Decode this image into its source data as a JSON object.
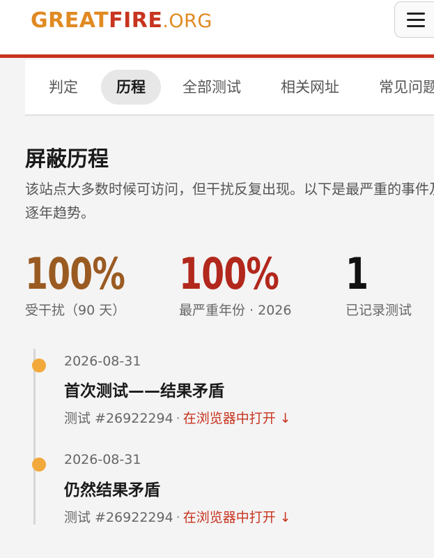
{
  "header": {
    "logo_great": "GREAT",
    "logo_fire": "FIRE",
    "logo_org": ".ORG"
  },
  "tabs": [
    {
      "label": "判定",
      "active": false
    },
    {
      "label": "历程",
      "active": true
    },
    {
      "label": "全部测试",
      "active": false
    },
    {
      "label": "相关网址",
      "active": false
    },
    {
      "label": "常见问题",
      "active": false
    }
  ],
  "section": {
    "title": "屏蔽历程",
    "description": "该站点大多数时候可访问，但干扰反复出现。以下是最严重的事件及逐年趋势。"
  },
  "stats": [
    {
      "value": "100%",
      "label": "受干扰（90 天）",
      "color": "#9a5b22"
    },
    {
      "value": "100%",
      "label": "最严重年份 · 2026",
      "color": "#b2281c"
    },
    {
      "value": "1",
      "label": "已记录测试",
      "color": "#111111"
    }
  ],
  "timeline": [
    {
      "date": "2026-08-31",
      "title": "首次测试——结果矛盾",
      "test_id": "测试 #26922294",
      "separator": "·",
      "link": "在浏览器中打开 ↓"
    },
    {
      "date": "2026-08-31",
      "title": "仍然结果矛盾",
      "test_id": "测试 #26922294",
      "separator": "·",
      "link": "在浏览器中打开 ↓"
    }
  ],
  "colors": {
    "accent_red": "#c7341f",
    "accent_orange": "#e08a22",
    "timeline_dot": "#f2a93b"
  }
}
